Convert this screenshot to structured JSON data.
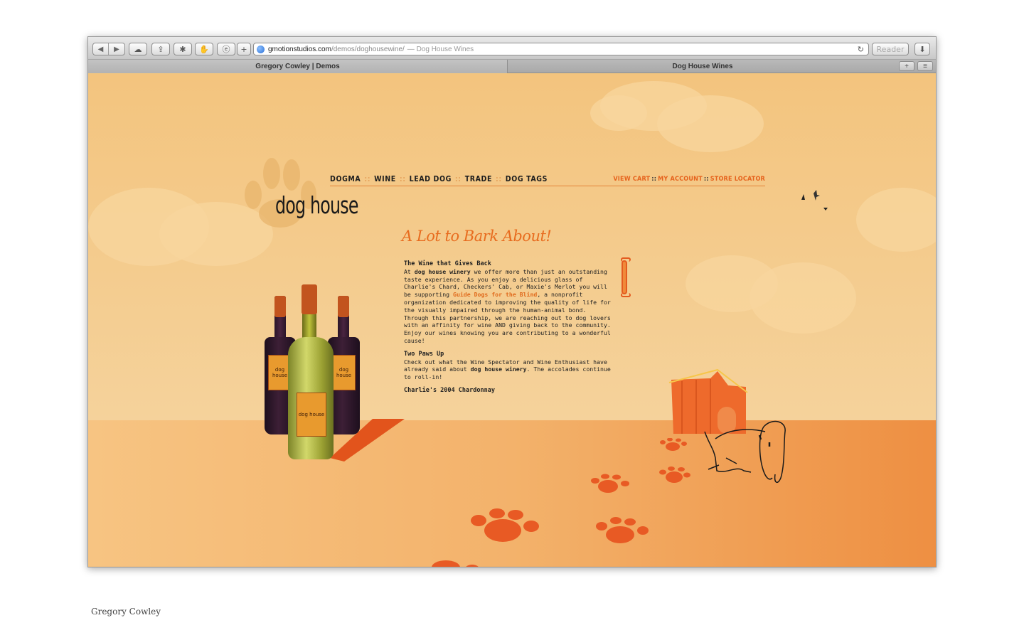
{
  "browser": {
    "url_host": "gmotionstudios.com",
    "url_path": "/demos/doghousewine/",
    "url_title": "— Dog House Wines",
    "reader_label": "Reader",
    "add_label": "+",
    "tabs": [
      {
        "label": "Gregory Cowley | Demos"
      },
      {
        "label": "Dog House Wines"
      }
    ]
  },
  "site": {
    "nav_left": [
      "DOGMA",
      "WINE",
      "LEAD DOG",
      "TRADE",
      "DOG TAGS"
    ],
    "nav_separator": "::",
    "nav_right": [
      "VIEW CART",
      "MY ACCOUNT",
      "STORE LOCATOR"
    ],
    "logo_text": "dog house",
    "headline": "A Lot to Bark About!",
    "section1": {
      "title": "The Wine that Gives Back",
      "intro": "At ",
      "brand": "dog house winery",
      "body1": " we offer more than just an outstanding taste experience.  As you enjoy a delicious glass of Charlie's Chard, Checkers' Cab, or Maxie's Merlot you will be supporting ",
      "link": "Guide Dogs for the Blind",
      "body2": ", a nonprofit organization dedicated to improving the quality of life for the visually impaired through the human-animal bond. Through this partnership, we are reaching out to dog lovers with an affinity for wine AND giving back to the community. Enjoy our wines knowing you are contributing to a wonderful cause!"
    },
    "section2": {
      "title": "Two Paws Up",
      "body1": "Check out what the Wine Spectator and Wine Enthusiast have already said about ",
      "brand": "dog house winery",
      "body2": ".  The accolades continue to roll-in!"
    },
    "section3": {
      "title": "Charlie's 2004 Chardonnay"
    },
    "bottle_label": "dog house"
  },
  "footer": {
    "caption": "Gregory Cowley"
  }
}
